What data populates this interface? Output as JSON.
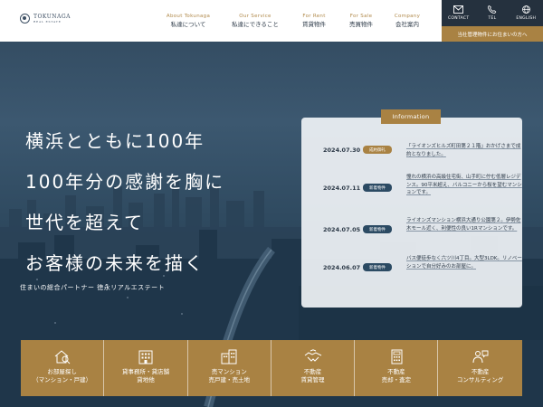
{
  "logo": {
    "name": "TOKUNAGA",
    "sub": "REAL ESTATE"
  },
  "nav": [
    {
      "en": "About Tokunaga",
      "jp": "私達について"
    },
    {
      "en": "Our Service",
      "jp": "私達にできること"
    },
    {
      "en": "For Rent",
      "jp": "賃貸物件"
    },
    {
      "en": "For Sale",
      "jp": "売買物件"
    },
    {
      "en": "Company",
      "jp": "会社案内"
    }
  ],
  "topbar": [
    {
      "label": "CONTACT",
      "icon": "mail-icon"
    },
    {
      "label": "TEL",
      "icon": "phone-icon"
    },
    {
      "label": "ENGLISH",
      "icon": "globe-icon"
    }
  ],
  "owner_link": "当社管理物件にお住まいの方へ",
  "hero": {
    "lines": [
      "横浜とともに100年",
      "100年分の感謝を胸に",
      "世代を超えて",
      "お客様の未来を描く"
    ],
    "sub": "住まいの総合パートナー 徳永リアルエステート"
  },
  "info": {
    "title": "Information",
    "items": [
      {
        "date": "2024.07.30",
        "badge": "成約御礼",
        "badge_color": "#a98243",
        "text": "「ライオンズヒルズ町田第２１階」おかげさまで成約となりました。"
      },
      {
        "date": "2024.07.11",
        "badge": "新着物件",
        "badge_color": "#2b4a63",
        "text": "憧れの横浜の高級住宅街、山手町に佇む低層レジデンス。90平米超え、バルコニーから桜を望むマンションです。"
      },
      {
        "date": "2024.07.05",
        "badge": "新着物件",
        "badge_color": "#2b4a63",
        "text": "ライオンズマンション横浜大通り公園第２。伊勢佐木モール近く、利便性の良い1Rマンションです。"
      },
      {
        "date": "2024.06.07",
        "badge": "新着物件",
        "badge_color": "#2b4a63",
        "text": "バス便徒歩なく六ツ川4丁目。大型3LDK。リノベーションで自分好みのお部屋に。"
      }
    ]
  },
  "services": [
    {
      "lines": [
        "お部屋探し",
        "（マンション・戸建）"
      ],
      "icon": "search-home-icon"
    },
    {
      "lines": [
        "貸事務所・貸店舗",
        "貸地他"
      ],
      "icon": "office-building-icon"
    },
    {
      "lines": [
        "売マンション",
        "売戸建・売土地"
      ],
      "icon": "apartment-icon"
    },
    {
      "lines": [
        "不動産",
        "賃貸管理"
      ],
      "icon": "handshake-icon"
    },
    {
      "lines": [
        "不動産",
        "売却・査定"
      ],
      "icon": "calculator-icon"
    },
    {
      "lines": [
        "不動産",
        "コンサルティング"
      ],
      "icon": "consulting-icon"
    }
  ]
}
